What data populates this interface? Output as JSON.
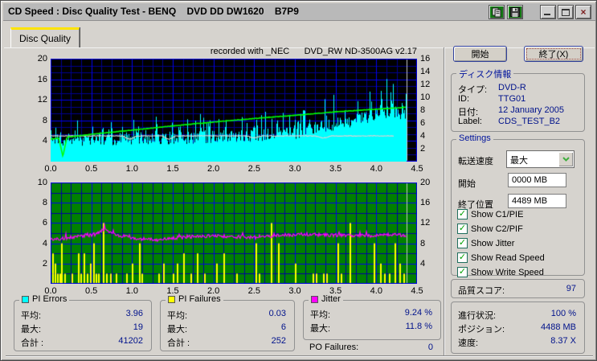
{
  "window": {
    "title": "CD Speed : Disc Quality Test - BENQ    DVD DD DW1620    B7P9",
    "close_glyph": "×"
  },
  "tab": {
    "label": "Disc Quality"
  },
  "note": "recorded with _NEC      DVD_RW ND-3500AG v2.17",
  "chart_data": [
    {
      "type": "area",
      "name": "pi-errors-speed-chart",
      "x_range": [
        0,
        4.5
      ],
      "data_end_x": 4.37,
      "x_ticks": [
        0,
        0.5,
        1,
        1.5,
        2,
        2.5,
        3,
        3.5,
        4,
        4.5
      ],
      "y_left": {
        "range": [
          0,
          20
        ],
        "ticks": [
          4,
          8,
          12,
          16,
          20
        ]
      },
      "y_right": {
        "range": [
          0,
          16
        ],
        "ticks": [
          2,
          4,
          6,
          8,
          10,
          12,
          14,
          16
        ]
      },
      "grid": {
        "minor_x_step": 0.125,
        "minor_y_div": 3,
        "major_x_step": 0.5,
        "major_y_step": 4
      },
      "colors": {
        "bg": "#000000",
        "grid_minor": "#000091",
        "grid_major": "#0000ef",
        "pi_errors": "#00ffff",
        "write_speed": "#00ff00",
        "read_speed": "#d4d4d4",
        "end_marker": "#c9c9c9"
      },
      "pi_errors": {
        "stats": {
          "average": 3.96,
          "maximum": 19,
          "total": 41202
        },
        "base_keypoints": [
          [
            0,
            4.3
          ],
          [
            0.5,
            4.3
          ],
          [
            1,
            4.5
          ],
          [
            1.5,
            4.6
          ],
          [
            2,
            4.8
          ],
          [
            2.5,
            5.1
          ],
          [
            3,
            5.6
          ],
          [
            3.2,
            6.3
          ],
          [
            3.5,
            7.3
          ],
          [
            3.8,
            8.3
          ],
          [
            4,
            9.3
          ],
          [
            4.2,
            9.8
          ],
          [
            4.37,
            9.2
          ]
        ],
        "spike_amp_keypoints": [
          [
            0,
            3.2
          ],
          [
            2.5,
            3.6
          ],
          [
            3,
            4.6
          ],
          [
            3.5,
            6
          ],
          [
            3.9,
            8.6
          ],
          [
            4.37,
            6.5
          ]
        ],
        "spike_probability": 0.28,
        "noise": 1.25,
        "max_clip": 19
      },
      "write_speed": {
        "keypoints_right_scale": [
          [
            0,
            3.5
          ],
          [
            0.5,
            4.25
          ],
          [
            1,
            4.9
          ],
          [
            1.5,
            5.55
          ],
          [
            2,
            6.15
          ],
          [
            2.5,
            6.7
          ],
          [
            3,
            7.2
          ],
          [
            3.5,
            7.75
          ],
          [
            4,
            8.15
          ],
          [
            4.37,
            8.45
          ]
        ],
        "dip": {
          "x": 0.15,
          "min": 0.8,
          "half_width": 0.05
        }
      },
      "read_speed": {
        "level_right_scale": 4.0,
        "end_x": 4.22,
        "dips": [
          {
            "x": 0.97,
            "depth": 0.5,
            "width": 0.1
          },
          {
            "x": 1.45,
            "depth": 0.5,
            "width": 0.1
          },
          {
            "x": 2.5,
            "depth": 0.3,
            "width": 0.1
          },
          {
            "x": 3.35,
            "depth": 0.3,
            "width": 0.12
          }
        ]
      },
      "noise_seed": 1337
    },
    {
      "type": "area",
      "name": "jitter-pif-chart",
      "x_range": [
        0,
        4.5
      ],
      "data_end_x": 4.37,
      "x_ticks": [
        0,
        0.5,
        1,
        1.5,
        2,
        2.5,
        3,
        3.5,
        4,
        4.5
      ],
      "y_left": {
        "range": [
          0,
          10
        ],
        "ticks": [
          2,
          4,
          6,
          8,
          10
        ]
      },
      "y_right": {
        "range": [
          0,
          20
        ],
        "ticks": [
          4,
          8,
          12,
          16,
          20
        ]
      },
      "grid": {
        "minor_x_step": 0.125,
        "minor_y_step": 1,
        "major_x_step": 0.5,
        "major_y_step": 2
      },
      "colors": {
        "bg": "#008000",
        "grid_minor": "#0000a0",
        "grid_major": "#0000ef",
        "pi_failures": "#ffff00",
        "jitter": "#ff00ff",
        "end_marker": "#c9c9c9"
      },
      "jitter": {
        "stats": {
          "average_pct": 9.24,
          "maximum_pct": 11.8
        },
        "base_keypoints": [
          [
            0,
            4.35
          ],
          [
            0.3,
            4.6
          ],
          [
            0.55,
            4.9
          ],
          [
            0.67,
            5.45
          ],
          [
            0.78,
            4.9
          ],
          [
            1,
            4.5
          ],
          [
            1.3,
            4.35
          ],
          [
            1.6,
            4.6
          ],
          [
            2,
            4.75
          ],
          [
            2.4,
            4.6
          ],
          [
            2.8,
            4.75
          ],
          [
            3.1,
            4.9
          ],
          [
            3.5,
            4.8
          ],
          [
            4,
            4.75
          ],
          [
            4.2,
            4.9
          ],
          [
            4.37,
            4.7
          ]
        ],
        "noise": 0.17
      },
      "pi_failures": {
        "stats": {
          "average": 0.03,
          "maximum": 6,
          "total": 252
        },
        "spikes": [
          [
            0.02,
            3
          ],
          [
            0.05,
            2
          ],
          [
            0.08,
            1
          ],
          [
            0.11,
            1
          ],
          [
            0.13,
            4
          ],
          [
            0.17,
            1
          ],
          [
            0.26,
            1
          ],
          [
            0.34,
            3
          ],
          [
            0.37,
            1
          ],
          [
            0.4,
            3
          ],
          [
            0.44,
            1
          ],
          [
            0.48,
            2
          ],
          [
            0.52,
            4
          ],
          [
            0.55,
            1
          ],
          [
            0.58,
            1
          ],
          [
            0.64,
            6
          ],
          [
            0.68,
            1
          ],
          [
            0.73,
            1
          ],
          [
            0.8,
            1
          ],
          [
            0.93,
            1
          ],
          [
            1,
            2
          ],
          [
            1.09,
            4
          ],
          [
            1.12,
            1
          ],
          [
            1.32,
            1
          ],
          [
            1.38,
            2
          ],
          [
            1.5,
            1
          ],
          [
            1.55,
            2
          ],
          [
            1.63,
            3
          ],
          [
            1.72,
            1
          ],
          [
            1.8,
            3
          ],
          [
            1.88,
            1
          ],
          [
            2.03,
            2
          ],
          [
            2.12,
            3
          ],
          [
            2.28,
            1
          ],
          [
            2.52,
            4
          ],
          [
            2.56,
            1
          ],
          [
            2.7,
            6
          ],
          [
            2.79,
            4
          ],
          [
            3,
            2
          ],
          [
            3.22,
            1
          ],
          [
            3.26,
            1
          ],
          [
            3.35,
            1
          ],
          [
            3.38,
            1
          ],
          [
            3.52,
            4
          ],
          [
            3.56,
            1
          ],
          [
            3.67,
            6
          ],
          [
            3.97,
            4
          ],
          [
            4.05,
            2
          ],
          [
            4.1,
            1
          ],
          [
            4.15,
            1
          ],
          [
            4.22,
            4
          ],
          [
            4.28,
            2
          ],
          [
            4.33,
            1
          ]
        ]
      },
      "noise_seed": 4242
    }
  ],
  "stats": {
    "pi_errors": {
      "title": "PI Errors",
      "swatch_color": "#00ffff",
      "rows": [
        {
          "label": "平均:",
          "value": "3.96"
        },
        {
          "label": "最大:",
          "value": "19"
        },
        {
          "label": "合計 :",
          "value": "41202"
        }
      ]
    },
    "pi_failures": {
      "title": "PI Failures",
      "swatch_color": "#ffff00",
      "rows": [
        {
          "label": "平均:",
          "value": "0.03"
        },
        {
          "label": "最大:",
          "value": "6"
        },
        {
          "label": "合計 :",
          "value": "252"
        }
      ]
    },
    "jitter": {
      "title": "Jitter",
      "swatch_color": "#ff00ff",
      "rows": [
        {
          "label": "平均:",
          "value": "9.24 %"
        },
        {
          "label": "最大:",
          "value": "11.8 %"
        }
      ]
    },
    "po_failures": {
      "label": "PO Failures:",
      "value": "0"
    }
  },
  "panel": {
    "start_button": "開始",
    "exit_button": "終了(X)",
    "disc_info": {
      "title": "ディスク情報",
      "rows": [
        {
          "label": "タイプ:",
          "value": "DVD-R"
        },
        {
          "label": "ID:",
          "value": "TTG01"
        },
        {
          "label": "日付:",
          "value": "12 January 2005"
        },
        {
          "label": "Label:",
          "value": "CDS_TEST_B2"
        }
      ]
    },
    "settings": {
      "title": "Settings",
      "transfer_rate_label": "転送速度",
      "transfer_rate_value": "最大",
      "start_label": "開始",
      "start_value": "0000 MB",
      "end_label": "終了位置",
      "end_value": "4489 MB",
      "check_glyph": "✓",
      "checkboxes": [
        {
          "label": "Show C1/PIE",
          "checked": true
        },
        {
          "label": "Show C2/PIF",
          "checked": true
        },
        {
          "label": "Show Jitter",
          "checked": true
        },
        {
          "label": "Show Read Speed",
          "checked": true
        },
        {
          "label": "Show Write Speed",
          "checked": true
        }
      ]
    },
    "quality_score": {
      "label": "品質スコア:",
      "value": "97"
    },
    "progress": {
      "rows": [
        {
          "label": "進行状況:",
          "value": "100 %"
        },
        {
          "label": "ポジション:",
          "value": "4488 MB"
        },
        {
          "label": "速度:",
          "value": "8.37 X"
        }
      ]
    }
  }
}
